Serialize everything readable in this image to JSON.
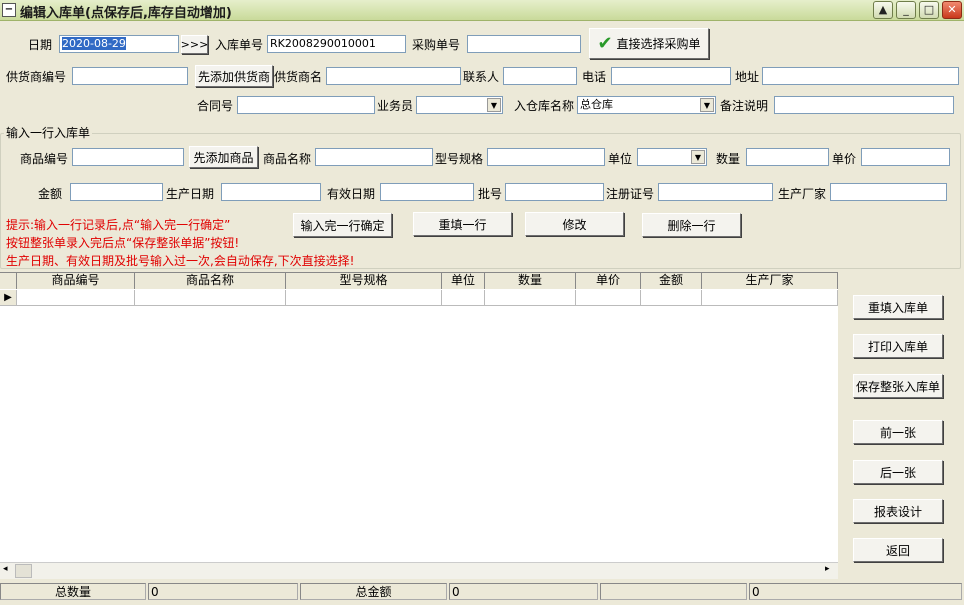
{
  "window": {
    "title": "编辑入库单(点保存后,库存自动增加)",
    "sys_icon": "minus-icon",
    "buttons": {
      "up": "▲",
      "minimize": "_",
      "maximize": "□",
      "close": "✕"
    }
  },
  "header": {
    "date_label": "日期",
    "date_value": "2020-08-29",
    "nav_label": ">>>",
    "order_no_label": "入库单号",
    "order_no_value": "RK2008290010001",
    "purchase_no_label": "采购单号",
    "purchase_no_value": "",
    "select_purchase_label": "直接选择采购单",
    "supplier_code_label": "供货商编号",
    "supplier_code_value": "",
    "add_supplier_label": "先添加供货商",
    "supplier_name_label": "供货商名",
    "supplier_name_value": "",
    "contact_label": "联系人",
    "contact_value": "",
    "phone_label": "电话",
    "phone_value": "",
    "address_label": "地址",
    "address_value": "",
    "contract_label": "合同号",
    "contract_value": "",
    "salesman_label": "业务员",
    "salesman_value": "",
    "warehouse_label": "入仓库名称",
    "warehouse_value": "总仓库",
    "remark_label": "备注说明",
    "remark_value": ""
  },
  "line_entry": {
    "group_title": "输入一行入库单",
    "product_code_label": "商品编号",
    "add_product_label": "先添加商品",
    "product_name_label": "商品名称",
    "spec_label": "型号规格",
    "unit_label": "单位",
    "qty_label": "数量",
    "price_label": "单价",
    "amount_label": "金额",
    "prod_date_label": "生产日期",
    "expiry_label": "有效日期",
    "batch_label": "批号",
    "reg_no_label": "注册证号",
    "maker_label": "生产厂家",
    "confirm_label": "输入完一行确定",
    "refill_label": "重填一行",
    "modify_label": "修改",
    "delete_label": "删除一行",
    "hint1": "提示:输入一行记录后,点“输入完一行确定”",
    "hint2": "按钮整张单录入完后点“保存整张单据”按钮!",
    "hint3": "生产日期、有效日期及批号输入过一次,会自动保存,下次直接选择!"
  },
  "grid": {
    "columns": [
      "商品编号",
      "商品名称",
      "型号规格",
      "单位",
      "数量",
      "单价",
      "金额",
      "生产厂家"
    ],
    "row_indicator": "▶"
  },
  "side_buttons": {
    "refill_order": "重填入库单",
    "print_order": "打印入库单",
    "save_order": "保存整张入库单",
    "prev": "前一张",
    "next": "后一张",
    "report_design": "报表设计",
    "back": "返回"
  },
  "status": {
    "total_qty_label": "总数量",
    "total_qty_value": "0",
    "total_amount_label": "总金额",
    "total_amount_value": "0",
    "extra_value": "0"
  },
  "colors": {
    "accent_red": "#E00000",
    "selection": "#316AC5",
    "check_green": "#2a9a2a"
  }
}
